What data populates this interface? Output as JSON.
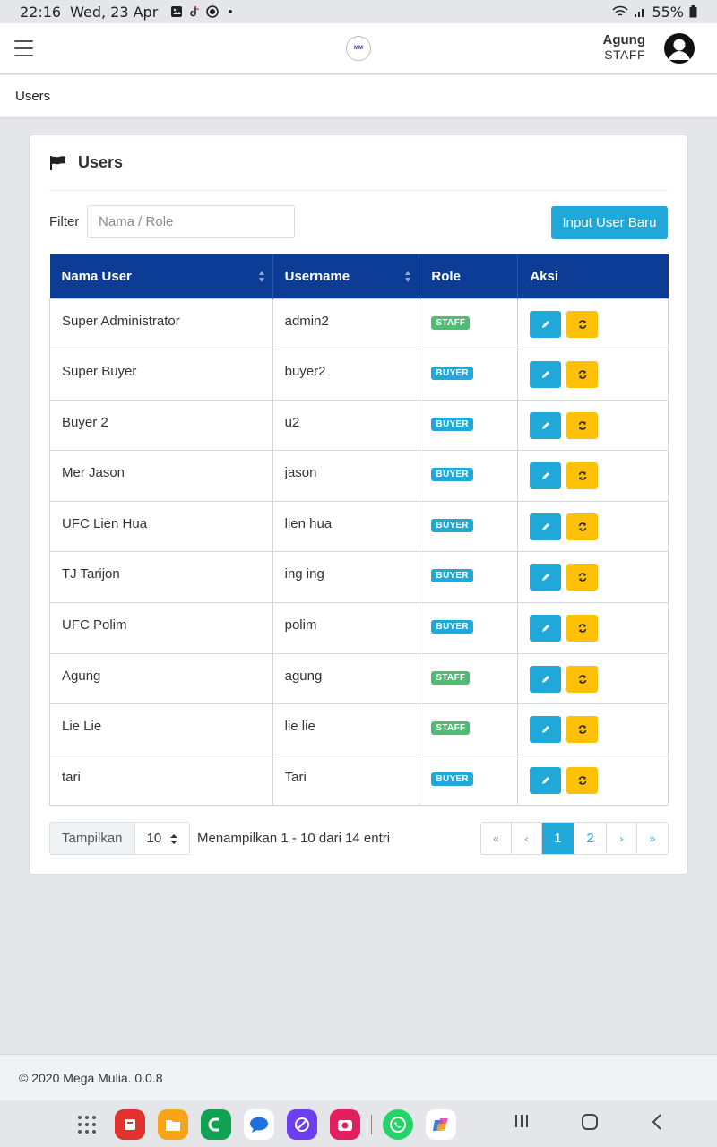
{
  "status_bar": {
    "time": "22:16",
    "date": "Wed, 23 Apr",
    "battery": "55%",
    "icons": [
      "gallery-icon",
      "tiktok-icon",
      "record-icon",
      "dot-icon",
      "wifi-icon",
      "signal-icon",
      "battery-icon"
    ]
  },
  "header": {
    "logo_text": "MM",
    "user_name": "Agung",
    "user_role": "STAFF"
  },
  "breadcrumb": "Users",
  "card": {
    "title": "Users",
    "filter_label": "Filter",
    "filter_placeholder": "Nama / Role",
    "new_button": "Input User Baru"
  },
  "table": {
    "columns": [
      "Nama User",
      "Username",
      "Role",
      "Aksi"
    ],
    "rows": [
      {
        "name": "Super Administrator",
        "username": "admin2",
        "role": "STAFF"
      },
      {
        "name": "Super Buyer",
        "username": "buyer2",
        "role": "BUYER"
      },
      {
        "name": "Buyer 2",
        "username": "u2",
        "role": "BUYER"
      },
      {
        "name": "Mer Jason",
        "username": "jason",
        "role": "BUYER"
      },
      {
        "name": "UFC Lien Hua",
        "username": "lien hua",
        "role": "BUYER"
      },
      {
        "name": "TJ Tarijon",
        "username": "ing ing",
        "role": "BUYER"
      },
      {
        "name": "UFC Polim",
        "username": "polim",
        "role": "BUYER"
      },
      {
        "name": "Agung",
        "username": "agung",
        "role": "STAFF"
      },
      {
        "name": "Lie Lie",
        "username": "lie lie",
        "role": "STAFF"
      },
      {
        "name": "tari",
        "username": "Tari",
        "role": "BUYER"
      }
    ]
  },
  "pagination": {
    "show_label": "Tampilkan",
    "page_size": "10",
    "info": "Menampilkan 1 - 10 dari 14 entri",
    "first": "«",
    "prev": "‹",
    "pages": [
      "1",
      "2"
    ],
    "current_page": "1",
    "next": "›",
    "last": "»"
  },
  "footer": "© 2020 Mega Mulia. 0.0.8",
  "colors": {
    "primary": "#20a8d8",
    "header_blue": "#0d3c96",
    "warning": "#ffc107",
    "success": "#4dbd74"
  }
}
